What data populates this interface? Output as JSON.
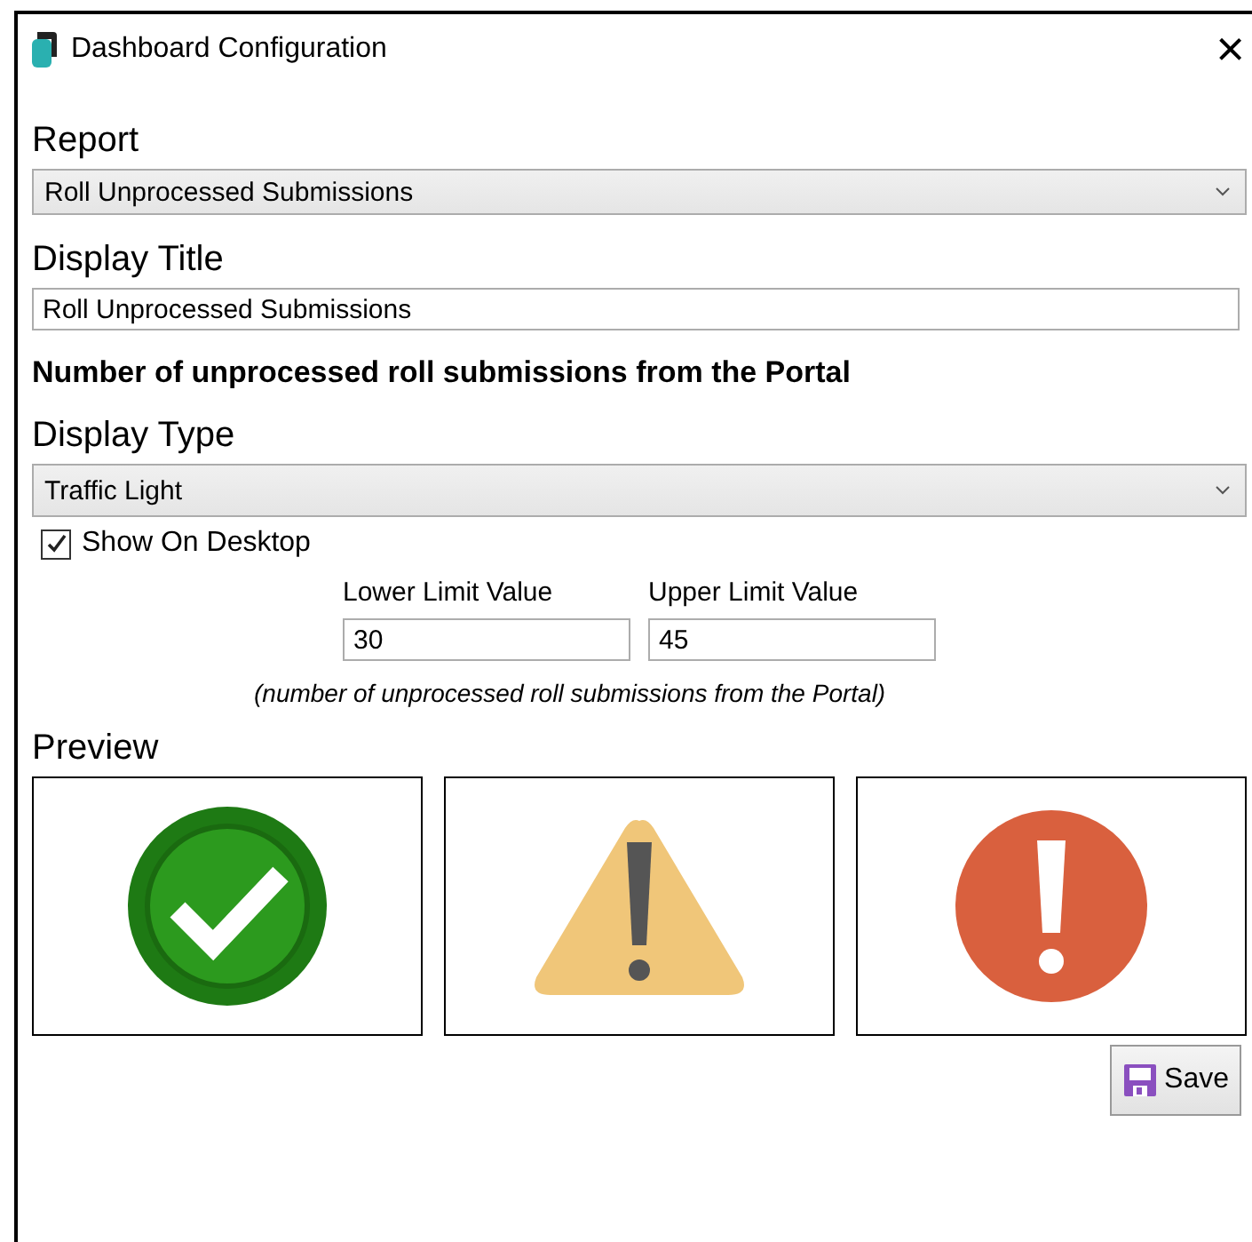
{
  "window": {
    "title": "Dashboard Configuration",
    "close": "×"
  },
  "report": {
    "label": "Report",
    "value": "Roll Unprocessed Submissions"
  },
  "display_title": {
    "label": "Display Title",
    "value": "Roll Unprocessed Submissions"
  },
  "description": "Number of unprocessed roll submissions from the Portal",
  "display_type": {
    "label": "Display Type",
    "value": "Traffic Light"
  },
  "show_on_desktop": {
    "label": "Show On Desktop",
    "checked": true
  },
  "limits": [
    {
      "label": "Lower Limit Value",
      "value": "30"
    },
    {
      "label": "Upper Limit Value",
      "value": "45"
    }
  ],
  "limits_note": "(number of unprocessed roll submissions from the Portal)",
  "preview": {
    "label": "Preview",
    "items": [
      {
        "kind": "ok"
      },
      {
        "kind": "warning"
      },
      {
        "kind": "error"
      }
    ]
  },
  "save_button": "Save"
}
